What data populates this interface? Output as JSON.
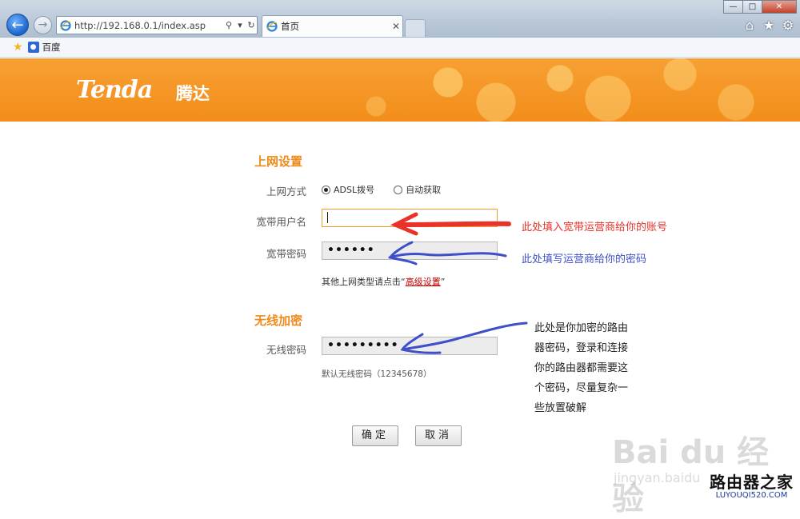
{
  "browser": {
    "url": "http://192.168.0.1/index.asp",
    "tab_title": "首页",
    "favorites": [
      {
        "label": "百度"
      }
    ]
  },
  "page": {
    "logo_en": "Tenda",
    "logo_cn": "腾达",
    "internet_section": {
      "title": "上网设置",
      "mode_label": "上网方式",
      "mode_options": [
        "ADSL拨号",
        "自动获取"
      ],
      "mode_selected": "ADSL拨号",
      "username_label": "宽带用户名",
      "username_value": "",
      "password_label": "宽带密码",
      "password_value": "••••••",
      "advanced_hint_prefix": "其他上网类型请点击“",
      "advanced_link": "高级设置",
      "advanced_hint_suffix": "”"
    },
    "wireless_section": {
      "title": "无线加密",
      "password_label": "无线密码",
      "password_value": "•••••••••",
      "default_hint": "默认无线密码（12345678）"
    },
    "buttons": {
      "ok": "确定",
      "cancel": "取消"
    }
  },
  "annotations": {
    "username_note": "此处填入宽带运营商给你的账号",
    "password_note": "此处填写运营商给你的密码",
    "wireless_note": [
      "此处是你加密的路由",
      "器密码，登录和连接",
      "你的路由器都需要这",
      "个密码，尽量复杂一",
      "些放置破解"
    ],
    "colors": {
      "red": "#e8322a",
      "blue": "#3f4fc9"
    }
  },
  "watermarks": {
    "baidu": "Bai du 经验",
    "jingyan": "jingyan.baidu",
    "site_name": "路由器之家",
    "site_url": "LUYOUQI520.COM"
  }
}
